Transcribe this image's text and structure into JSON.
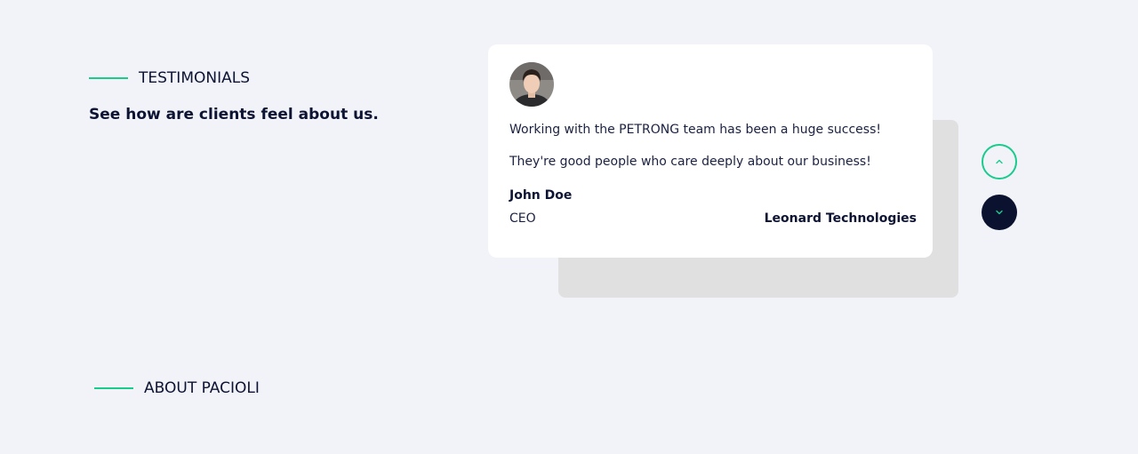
{
  "testimonials": {
    "eyebrow": "TESTIMONIALS",
    "subtitle": "See how are clients feel about us.",
    "card": {
      "quote": "Working with the PETRONG team has been a huge success! They're good people who care deeply about our business!",
      "name": "John Doe",
      "role": "CEO",
      "company": "Leonard Technologies"
    },
    "nav": {
      "up_icon": "chevron-up-icon",
      "down_icon": "chevron-down-icon"
    }
  },
  "about": {
    "eyebrow": "ABOUT PACIOLI"
  },
  "colors": {
    "accent": "#19cc8c",
    "navy": "#0b1230",
    "background": "#f1f3f8"
  }
}
